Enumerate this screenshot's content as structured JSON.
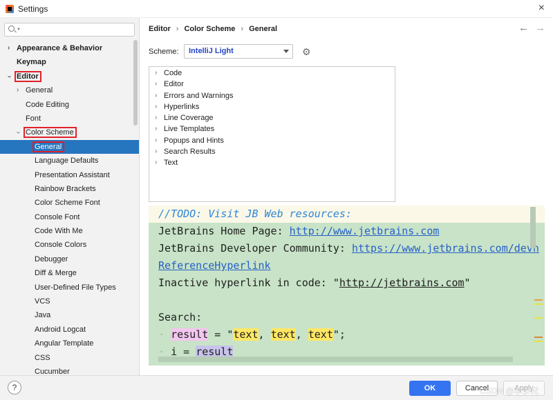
{
  "window": {
    "title": "Settings",
    "close_icon": "×"
  },
  "search": {
    "placeholder": "",
    "icon": "search-icon"
  },
  "sidebar": {
    "items": [
      {
        "label": "Appearance & Behavior",
        "level": 0,
        "bold": true,
        "expander": "collapsed"
      },
      {
        "label": "Keymap",
        "level": 0,
        "bold": true,
        "expander": "none"
      },
      {
        "label": "Editor",
        "level": 0,
        "bold": true,
        "expander": "expanded",
        "highlighted": true
      },
      {
        "label": "General",
        "level": 1,
        "expander": "collapsed"
      },
      {
        "label": "Code Editing",
        "level": 1,
        "expander": "none"
      },
      {
        "label": "Font",
        "level": 1,
        "expander": "none"
      },
      {
        "label": "Color Scheme",
        "level": 1,
        "expander": "expanded",
        "highlighted": true
      },
      {
        "label": "General",
        "level": 2,
        "expander": "none",
        "selected": true,
        "highlighted": true
      },
      {
        "label": "Language Defaults",
        "level": 2,
        "expander": "none"
      },
      {
        "label": "Presentation Assistant",
        "level": 2,
        "expander": "none"
      },
      {
        "label": "Rainbow Brackets",
        "level": 2,
        "expander": "none"
      },
      {
        "label": "Color Scheme Font",
        "level": 2,
        "expander": "none"
      },
      {
        "label": "Console Font",
        "level": 2,
        "expander": "none"
      },
      {
        "label": "Code With Me",
        "level": 2,
        "expander": "none"
      },
      {
        "label": "Console Colors",
        "level": 2,
        "expander": "none"
      },
      {
        "label": "Debugger",
        "level": 2,
        "expander": "none"
      },
      {
        "label": "Diff & Merge",
        "level": 2,
        "expander": "none"
      },
      {
        "label": "User-Defined File Types",
        "level": 2,
        "expander": "none"
      },
      {
        "label": "VCS",
        "level": 2,
        "expander": "none"
      },
      {
        "label": "Java",
        "level": 2,
        "expander": "none"
      },
      {
        "label": "Android Logcat",
        "level": 2,
        "expander": "none"
      },
      {
        "label": "Angular Template",
        "level": 2,
        "expander": "none"
      },
      {
        "label": "CSS",
        "level": 2,
        "expander": "none"
      },
      {
        "label": "Cucumber",
        "level": 2,
        "expander": "none"
      }
    ]
  },
  "breadcrumb": {
    "items": [
      "Editor",
      "Color Scheme",
      "General"
    ],
    "separator": "›"
  },
  "nav": {
    "back": "←",
    "forward": "→"
  },
  "scheme": {
    "label": "Scheme:",
    "value": "IntelliJ Light"
  },
  "categories": [
    "Code",
    "Editor",
    "Errors and Warnings",
    "Hyperlinks",
    "Line Coverage",
    "Live Templates",
    "Popups and Hints",
    "Search Results",
    "Text"
  ],
  "preview": {
    "todo": "//TODO: Visit JB Web resources:",
    "home_label": "JetBrains Home Page: ",
    "home_link": "http://www.jetbrains.com",
    "dev_label": "JetBrains Developer Community: ",
    "dev_link": "https://www.jetbrains.com/devn",
    "ref_link": "ReferenceHyperlink",
    "inactive_label": "Inactive hyperlink in code: \"",
    "inactive_link": "http://jetbrains.com",
    "inactive_end": "\"",
    "search_label": "Search:",
    "result_word": "result",
    "eq": " = \"",
    "text1": "text",
    "comma": ", ",
    "text2": "text",
    "text3": "text",
    "end": "\";",
    "i_var": "i",
    "eq2": " = ",
    "result2": "result"
  },
  "buttons": {
    "ok": "OK",
    "cancel": "Cancel",
    "apply": "Apply",
    "help": "?"
  },
  "watermark": "CSDN @李少兄",
  "colors": {
    "selection": "#2675bf",
    "highlight_box": "#e0202a",
    "preview_bg": "#c8e3c7",
    "ok_button": "#3574f0",
    "scheme_text": "#2344c8"
  }
}
